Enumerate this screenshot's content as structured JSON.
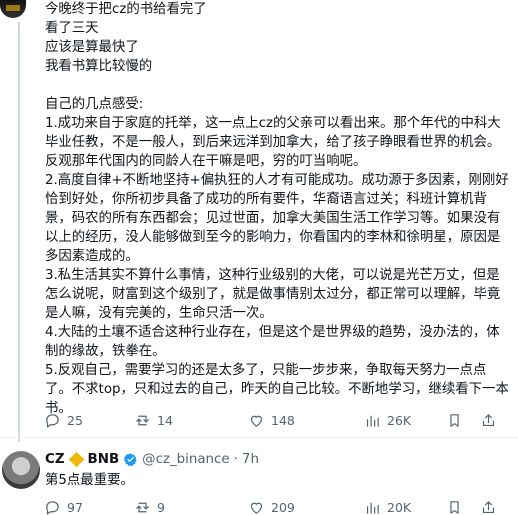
{
  "post": {
    "lines": [
      "今晚终于把cz的书给看完了",
      "看了三天",
      "应该是算最快了",
      "我看书算比较慢的",
      "",
      "自己的几点感受:",
      "1.成功来自于家庭的托举，这一点上cz的父亲可以看出来。那个年代的中科大",
      "毕业任教，不是一般人，到后来远洋到加拿大，给了孩子睁眼看世界的机会。",
      "反观那年代国内的同龄人在干嘛是吧，穷的叮当响呢。",
      "2.高度自律+不断地坚持+偏执狂的人才有可能成功。成功源于多因素，刚刚好",
      "恰到好处，你所初步具备了成功的所有要件，华裔语言过关；科班计算机背",
      "景，码农的所有东西都会；见过世面，加拿大美国生活工作学习等。如果没有",
      "以上的经历，没人能够做到至今的影响力，你看国内的李林和徐明星，原因是",
      "多因素造成的。",
      "3.私生活其实不算什么事情，这种行业级别的大佬，可以说是光芒万丈，但是",
      "怎么说呢，财富到这个级别了，就是做事情别太过分，都正常可以理解，毕竟",
      "是人嘛，没有完美的，生命只活一次。",
      "4.大陆的土壤不适合这种行业存在，但是这个是世界级的趋势，没办法的，体",
      "制的缘故，铁拳在。",
      "5.反观自己，需要学习的还是太多了，只能一步步来，争取每天努力一点点",
      "了。不求top，只和过去的自己，昨天的自己比较。不断地学习，继续看下一本",
      "书。"
    ],
    "stats": {
      "replies": "25",
      "reposts": "14",
      "likes": "148",
      "views": "26K"
    }
  },
  "reply": {
    "name": "CZ",
    "badge": "BNB",
    "handle": "@cz_binance",
    "dot": "·",
    "time": "7h",
    "text": "第5点最重要。",
    "stats": {
      "replies": "97",
      "reposts": "9",
      "likes": "209",
      "views": "20K"
    }
  },
  "colors": {
    "text": "#0f1419",
    "muted": "#536471",
    "verified": "#1d9bf0",
    "bnb": "#f0b90b"
  }
}
